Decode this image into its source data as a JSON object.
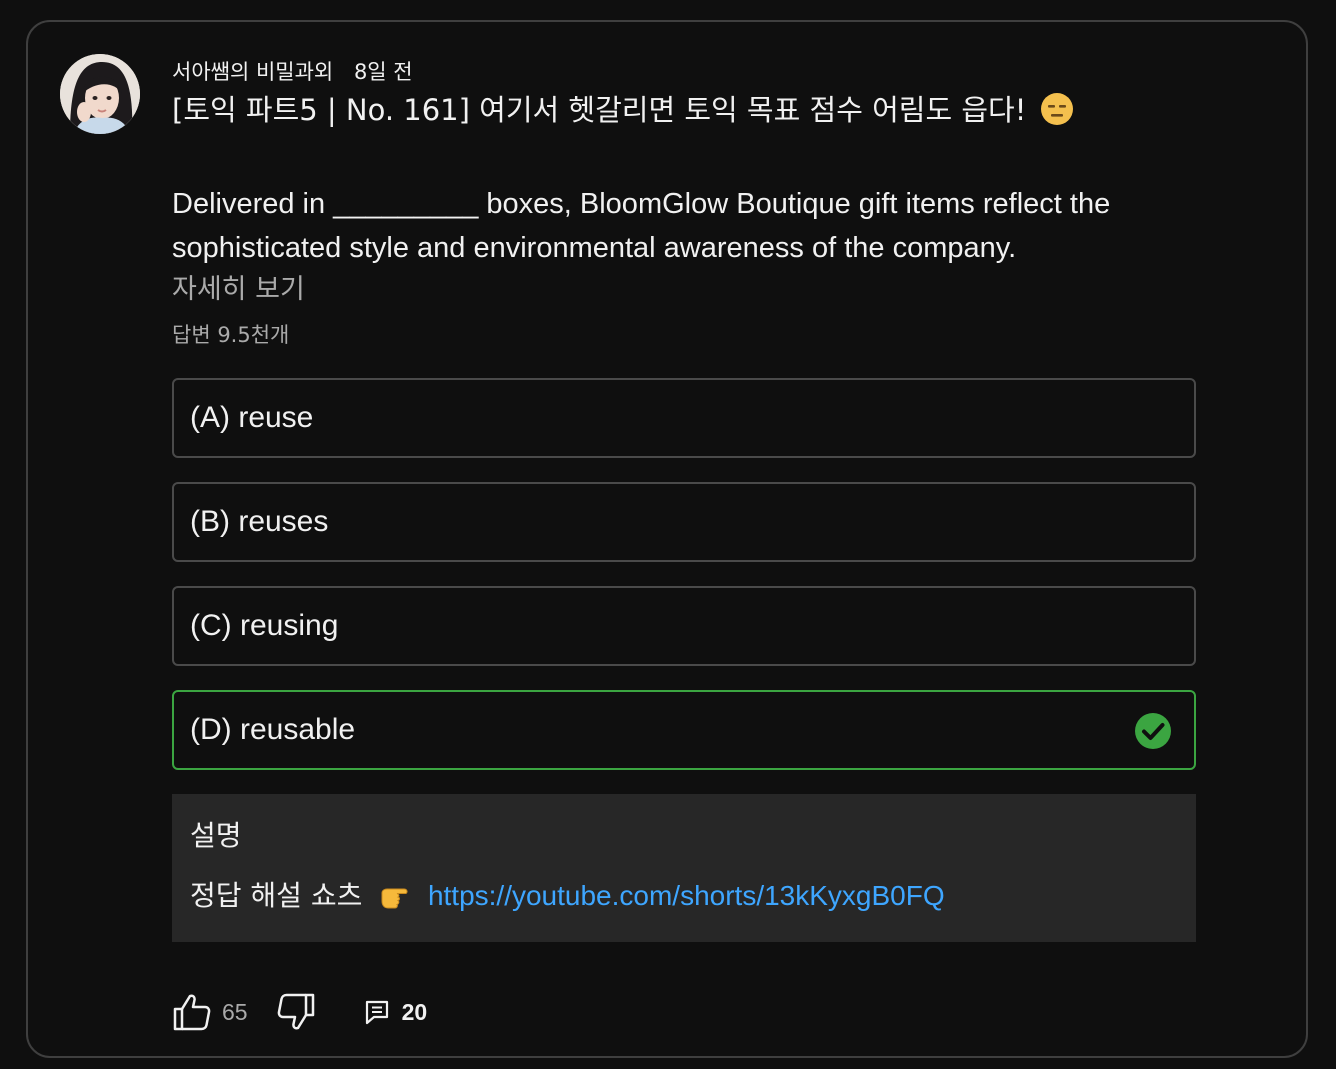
{
  "post": {
    "author": "서아쌤의 비밀과외",
    "time": "8일 전",
    "title": "[토익 파트5 | No. 161] 여기서 헷갈리면 토익 목표 점수 어림도 읍다!",
    "title_emoji": "expressionless-face-emoji",
    "body": "Delivered in _________ boxes, BloomGlow Boutique gift items reflect the sophisticated style and environmental awareness of the company.",
    "more_label": "자세히 보기",
    "answers": "답변 9.5천개"
  },
  "quiz": {
    "options": [
      {
        "label": "(A) reuse",
        "correct": false
      },
      {
        "label": "(B) reuses",
        "correct": false
      },
      {
        "label": "(C) reusing",
        "correct": false
      },
      {
        "label": "(D) reusable",
        "correct": true
      }
    ],
    "correct_color": "#3ba541"
  },
  "explanation": {
    "title": "설명",
    "prefix": "정답 해설 쇼츠",
    "link": "https://youtube.com/shorts/13kKyxgB0FQ"
  },
  "actions": {
    "likes": "65",
    "comments": "20"
  },
  "colors": {
    "background": "#0f0f0f",
    "border": "#3f3f3f",
    "link": "#3ea6ff",
    "explanation_bg": "#272727"
  }
}
